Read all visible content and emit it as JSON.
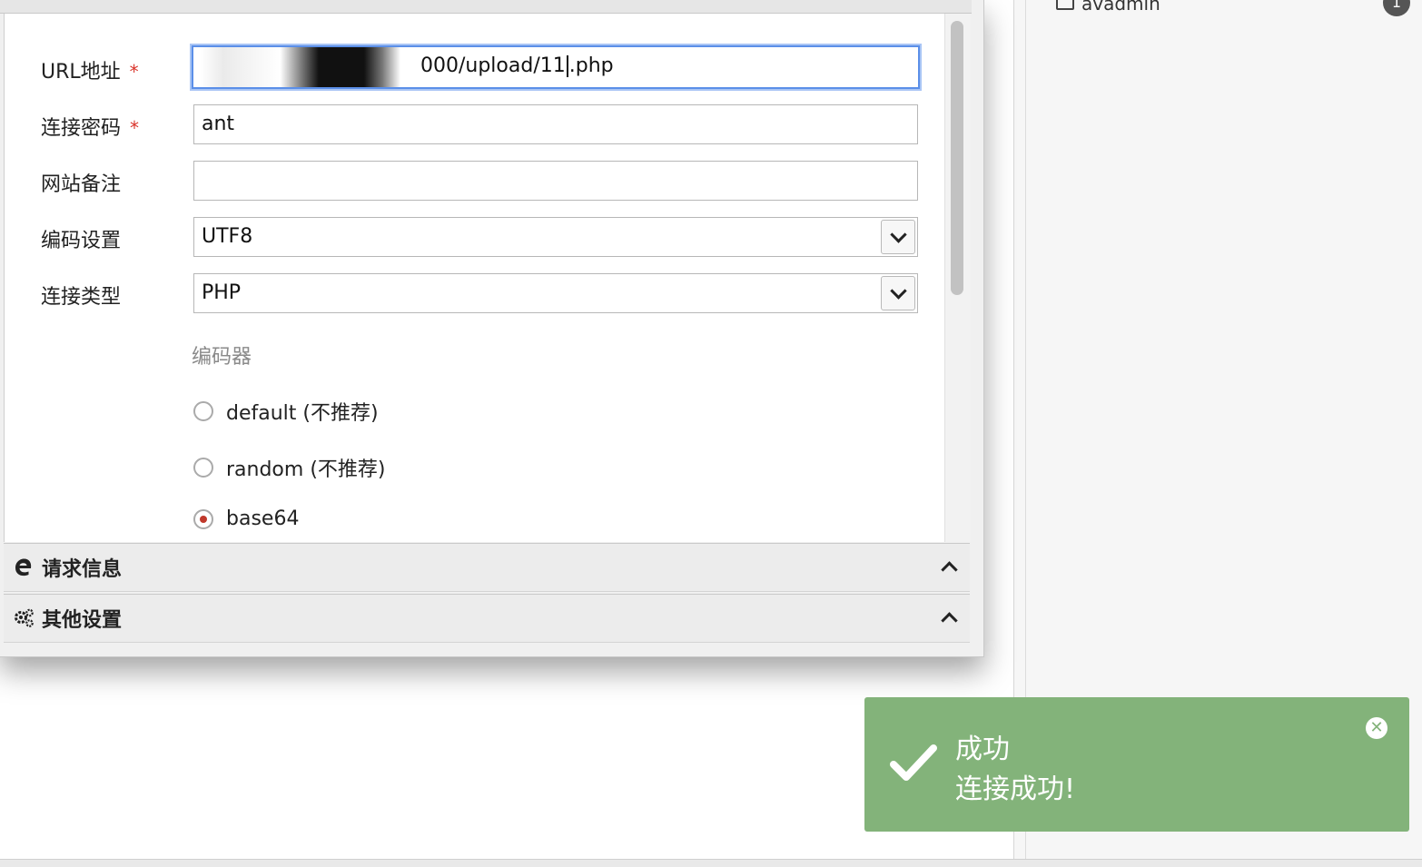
{
  "sidebar": {
    "tree_item_label": "avadmin",
    "badge_count": "1"
  },
  "form": {
    "url": {
      "label": "URL地址",
      "required_mark": "*",
      "value_visible": "000/upload/11",
      "value_suffix": ".php"
    },
    "password": {
      "label": "连接密码",
      "required_mark": "*",
      "value": "ant"
    },
    "note": {
      "label": "网站备注",
      "value": ""
    },
    "encoding": {
      "label": "编码设置",
      "value": "UTF8"
    },
    "conn_type": {
      "label": "连接类型",
      "value": "PHP"
    },
    "encoder_section_label": "编码器",
    "encoders": [
      {
        "label": "default (不推荐)",
        "selected": false
      },
      {
        "label": "random (不推荐)",
        "selected": false
      },
      {
        "label": "base64",
        "selected": true
      }
    ]
  },
  "accordions": [
    {
      "title": "请求信息",
      "icon": "edge-browser-icon"
    },
    {
      "title": "其他设置",
      "icon": "gears-icon"
    }
  ],
  "toast": {
    "title": "成功",
    "message": "连接成功!",
    "color": "#83b37a"
  }
}
